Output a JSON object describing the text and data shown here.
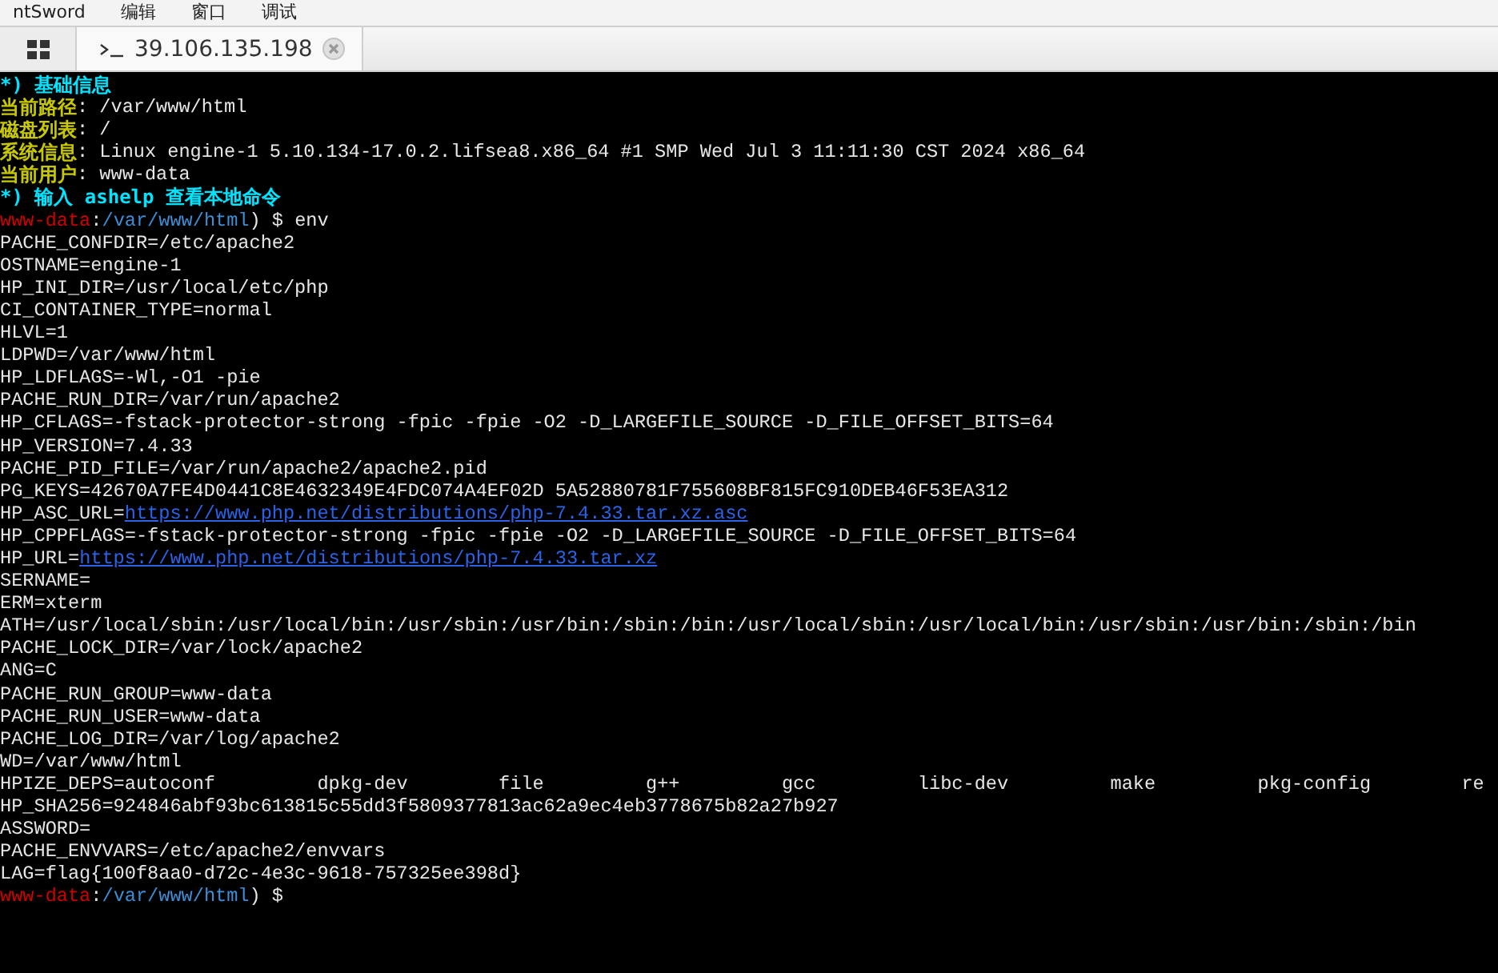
{
  "menu_bar": {
    "items": [
      "ntSword",
      "编辑",
      "窗口",
      "调试"
    ]
  },
  "tabs": [
    {
      "label": "39.106.135.198",
      "selected": true
    }
  ],
  "terminal": {
    "lines": [
      [
        {
          "kind": "heading",
          "text": "*) 基础信息"
        }
      ],
      [
        {
          "kind": "label",
          "text": "当前路径"
        },
        {
          "kind": "text",
          "text": ": /var/www/html"
        }
      ],
      [
        {
          "kind": "label",
          "text": "磁盘列表"
        },
        {
          "kind": "text",
          "text": ": /"
        }
      ],
      [
        {
          "kind": "label",
          "text": "系统信息"
        },
        {
          "kind": "text",
          "text": ": Linux engine-1 5.10.134-17.0.2.lifsea8.x86_64 #1 SMP Wed Jul 3 11:11:30 CST 2024 x86_64"
        }
      ],
      [
        {
          "kind": "label",
          "text": "当前用户"
        },
        {
          "kind": "text",
          "text": ": www-data"
        }
      ],
      [
        {
          "kind": "heading",
          "text": "*) 输入 ashelp 查看本地命令"
        }
      ],
      [
        {
          "kind": "user",
          "text": "www-data"
        },
        {
          "kind": "text",
          "text": ":"
        },
        {
          "kind": "path",
          "text": "/var/www/html"
        },
        {
          "kind": "text",
          "text": ") $ env"
        }
      ],
      [
        {
          "kind": "text",
          "text": "PACHE_CONFDIR=/etc/apache2"
        }
      ],
      [
        {
          "kind": "text",
          "text": "OSTNAME=engine-1"
        }
      ],
      [
        {
          "kind": "text",
          "text": "HP_INI_DIR=/usr/local/etc/php"
        }
      ],
      [
        {
          "kind": "text",
          "text": "CI_CONTAINER_TYPE=normal"
        }
      ],
      [
        {
          "kind": "text",
          "text": "HLVL=1"
        }
      ],
      [
        {
          "kind": "text",
          "text": "LDPWD=/var/www/html"
        }
      ],
      [
        {
          "kind": "text",
          "text": "HP_LDFLAGS=-Wl,-O1 -pie"
        }
      ],
      [
        {
          "kind": "text",
          "text": "PACHE_RUN_DIR=/var/run/apache2"
        }
      ],
      [
        {
          "kind": "text",
          "text": "HP_CFLAGS=-fstack-protector-strong -fpic -fpie -O2 -D_LARGEFILE_SOURCE -D_FILE_OFFSET_BITS=64"
        }
      ],
      [
        {
          "kind": "text",
          "text": "HP_VERSION=7.4.33"
        }
      ],
      [
        {
          "kind": "text",
          "text": "PACHE_PID_FILE=/var/run/apache2/apache2.pid"
        }
      ],
      [
        {
          "kind": "text",
          "text": "PG_KEYS=42670A7FE4D0441C8E4632349E4FDC074A4EF02D 5A52880781F755608BF815FC910DEB46F53EA312"
        }
      ],
      [
        {
          "kind": "text",
          "text": "HP_ASC_URL="
        },
        {
          "kind": "link",
          "text": "https://www.php.net/distributions/php-7.4.33.tar.xz.asc"
        }
      ],
      [
        {
          "kind": "text",
          "text": "HP_CPPFLAGS=-fstack-protector-strong -fpic -fpie -O2 -D_LARGEFILE_SOURCE -D_FILE_OFFSET_BITS=64"
        }
      ],
      [
        {
          "kind": "text",
          "text": "HP_URL="
        },
        {
          "kind": "link",
          "text": "https://www.php.net/distributions/php-7.4.33.tar.xz"
        }
      ],
      [
        {
          "kind": "text",
          "text": "SERNAME="
        }
      ],
      [
        {
          "kind": "text",
          "text": "ERM=xterm"
        }
      ],
      [
        {
          "kind": "text",
          "text": "ATH=/usr/local/sbin:/usr/local/bin:/usr/sbin:/usr/bin:/sbin:/bin:/usr/local/sbin:/usr/local/bin:/usr/sbin:/usr/bin:/sbin:/bin"
        }
      ],
      [
        {
          "kind": "text",
          "text": "PACHE_LOCK_DIR=/var/lock/apache2"
        }
      ],
      [
        {
          "kind": "text",
          "text": "ANG=C"
        }
      ],
      [
        {
          "kind": "text",
          "text": "PACHE_RUN_GROUP=www-data"
        }
      ],
      [
        {
          "kind": "text",
          "text": "PACHE_RUN_USER=www-data"
        }
      ],
      [
        {
          "kind": "text",
          "text": "PACHE_LOG_DIR=/var/log/apache2"
        }
      ],
      [
        {
          "kind": "text",
          "text": "WD=/var/www/html"
        }
      ],
      [
        {
          "kind": "text",
          "text": "HPIZE_DEPS=autoconf         dpkg-dev        file         g++         gcc         libc-dev         make         pkg-config        re"
        }
      ],
      [
        {
          "kind": "text",
          "text": "HP_SHA256=924846abf93bc613815c55dd3f5809377813ac62a9ec4eb3778675b82a27b927"
        }
      ],
      [
        {
          "kind": "text",
          "text": "ASSWORD="
        }
      ],
      [
        {
          "kind": "text",
          "text": "PACHE_ENVVARS=/etc/apache2/envvars"
        }
      ],
      [
        {
          "kind": "text",
          "text": "LAG=flag{100f8aa0-d72c-4e3c-9618-757325ee398d}"
        }
      ],
      [
        {
          "kind": "user",
          "text": "www-data"
        },
        {
          "kind": "text",
          "text": ":"
        },
        {
          "kind": "path",
          "text": "/var/www/html"
        },
        {
          "kind": "text",
          "text": ") $"
        }
      ]
    ]
  }
}
